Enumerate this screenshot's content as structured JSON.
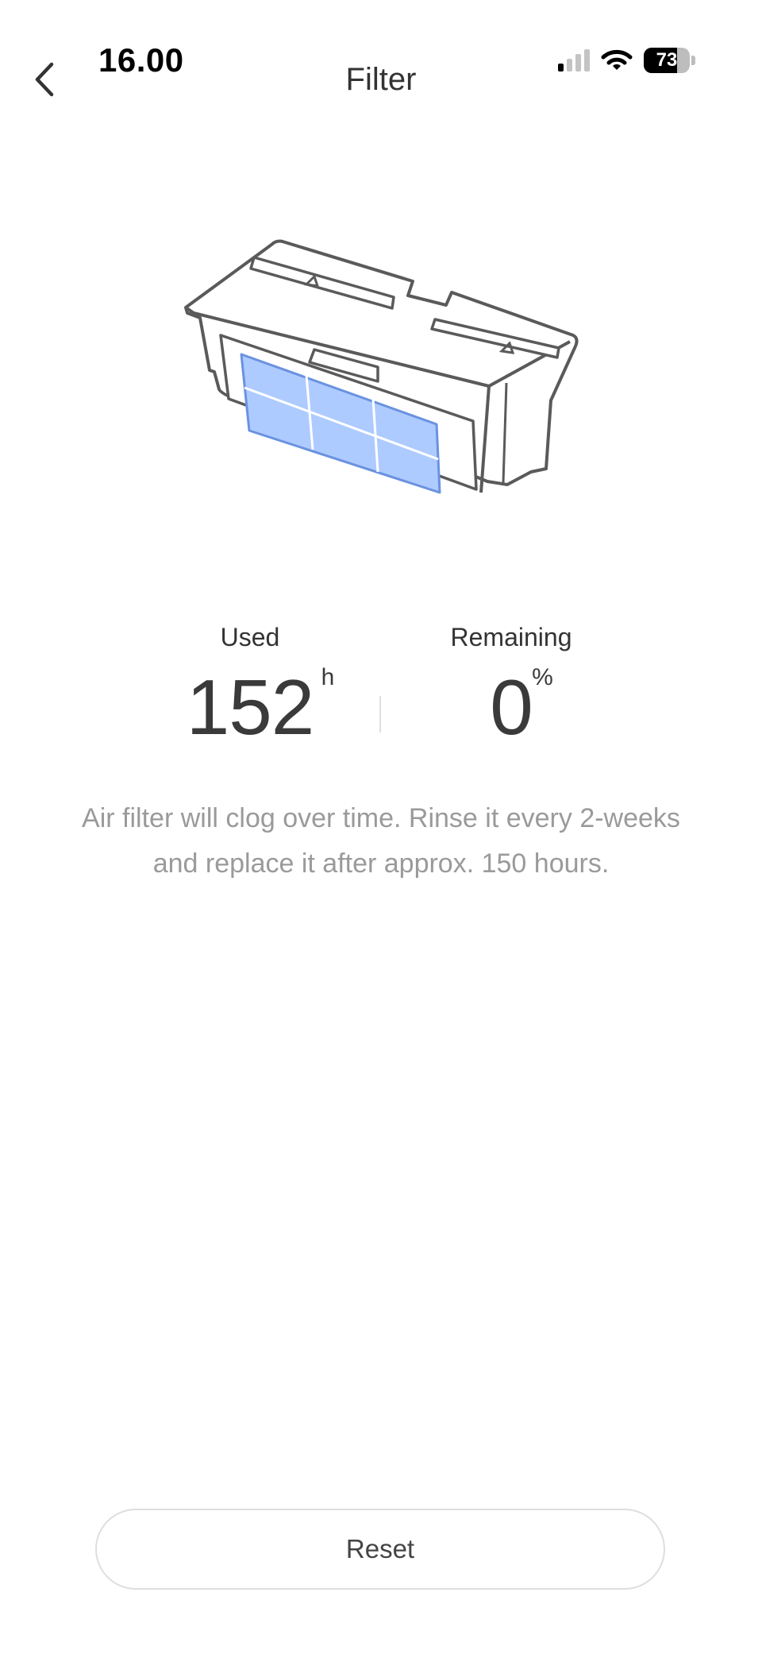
{
  "status_bar": {
    "time": "16.00",
    "battery_level": "73",
    "signal_bars_active": 1,
    "signal_bars_total": 4,
    "icons": [
      "cellular-signal-icon",
      "wifi-icon",
      "battery-icon"
    ]
  },
  "header": {
    "back_icon": "chevron-left-icon",
    "title": "Filter"
  },
  "illustration": {
    "subject": "filter-cartridge-illustration",
    "accent_color": "#aecbff"
  },
  "stats": {
    "used": {
      "label": "Used",
      "value": "152",
      "unit": "h"
    },
    "remaining": {
      "label": "Remaining",
      "value": "0",
      "unit": "%"
    }
  },
  "hint_text": "Air filter will clog over time. Rinse it every 2-weeks and replace it after approx. 150 hours.",
  "actions": {
    "reset_label": "Reset"
  }
}
